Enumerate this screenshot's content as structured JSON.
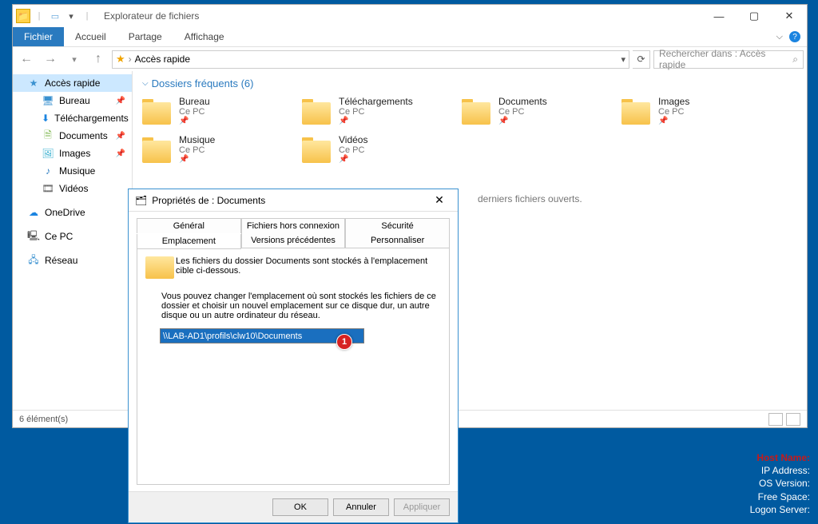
{
  "window": {
    "title": "Explorateur de fichiers",
    "tabs": {
      "file": "Fichier",
      "home": "Accueil",
      "share": "Partage",
      "view": "Affichage"
    },
    "nav": {
      "breadcrumb": "Accès rapide",
      "search_placeholder": "Rechercher dans : Accès rapide"
    },
    "controls": {
      "min": "—",
      "max": "▢",
      "close": "✕"
    }
  },
  "sidebar": {
    "quick": "Accès rapide",
    "items": [
      {
        "label": "Bureau",
        "icon": "desktop-icon"
      },
      {
        "label": "Téléchargements",
        "icon": "download-icon"
      },
      {
        "label": "Documents",
        "icon": "document-icon"
      },
      {
        "label": "Images",
        "icon": "image-icon"
      },
      {
        "label": "Musique",
        "icon": "music-icon"
      },
      {
        "label": "Vidéos",
        "icon": "video-icon"
      }
    ],
    "onedrive": "OneDrive",
    "thispc": "Ce PC",
    "network": "Réseau"
  },
  "content": {
    "section": "Dossiers fréquents (6)",
    "recent_note": "derniers fichiers ouverts.",
    "folders": [
      {
        "name": "Bureau",
        "loc": "Ce PC"
      },
      {
        "name": "Téléchargements",
        "loc": "Ce PC"
      },
      {
        "name": "Documents",
        "loc": "Ce PC"
      },
      {
        "name": "Images",
        "loc": "Ce PC"
      },
      {
        "name": "Musique",
        "loc": "Ce PC"
      },
      {
        "name": "Vidéos",
        "loc": "Ce PC"
      }
    ]
  },
  "status": {
    "count": "6 élément(s)"
  },
  "dialog": {
    "title": "Propriétés de : Documents",
    "tabs_row1": [
      "Général",
      "Fichiers hors connexion",
      "Sécurité"
    ],
    "tabs_row2": [
      "Emplacement",
      "Versions précédentes",
      "Personnaliser"
    ],
    "active_tab": "Emplacement",
    "desc1": "Les fichiers du dossier Documents sont stockés à l'emplacement cible ci-dessous.",
    "desc2": "Vous pouvez changer l'emplacement où sont stockés les fichiers de ce dossier et choisir un nouvel emplacement sur ce disque dur, un autre disque ou un autre ordinateur du réseau.",
    "path": "\\\\LAB-AD1\\profils\\clw10\\Documents",
    "buttons": {
      "ok": "OK",
      "cancel": "Annuler",
      "apply": "Appliquer"
    },
    "callout": "1"
  },
  "desktop": {
    "hostname": "Host Name:",
    "lines": [
      "IP Address:",
      "OS Version:",
      "Free Space:",
      "Logon Server:"
    ]
  }
}
